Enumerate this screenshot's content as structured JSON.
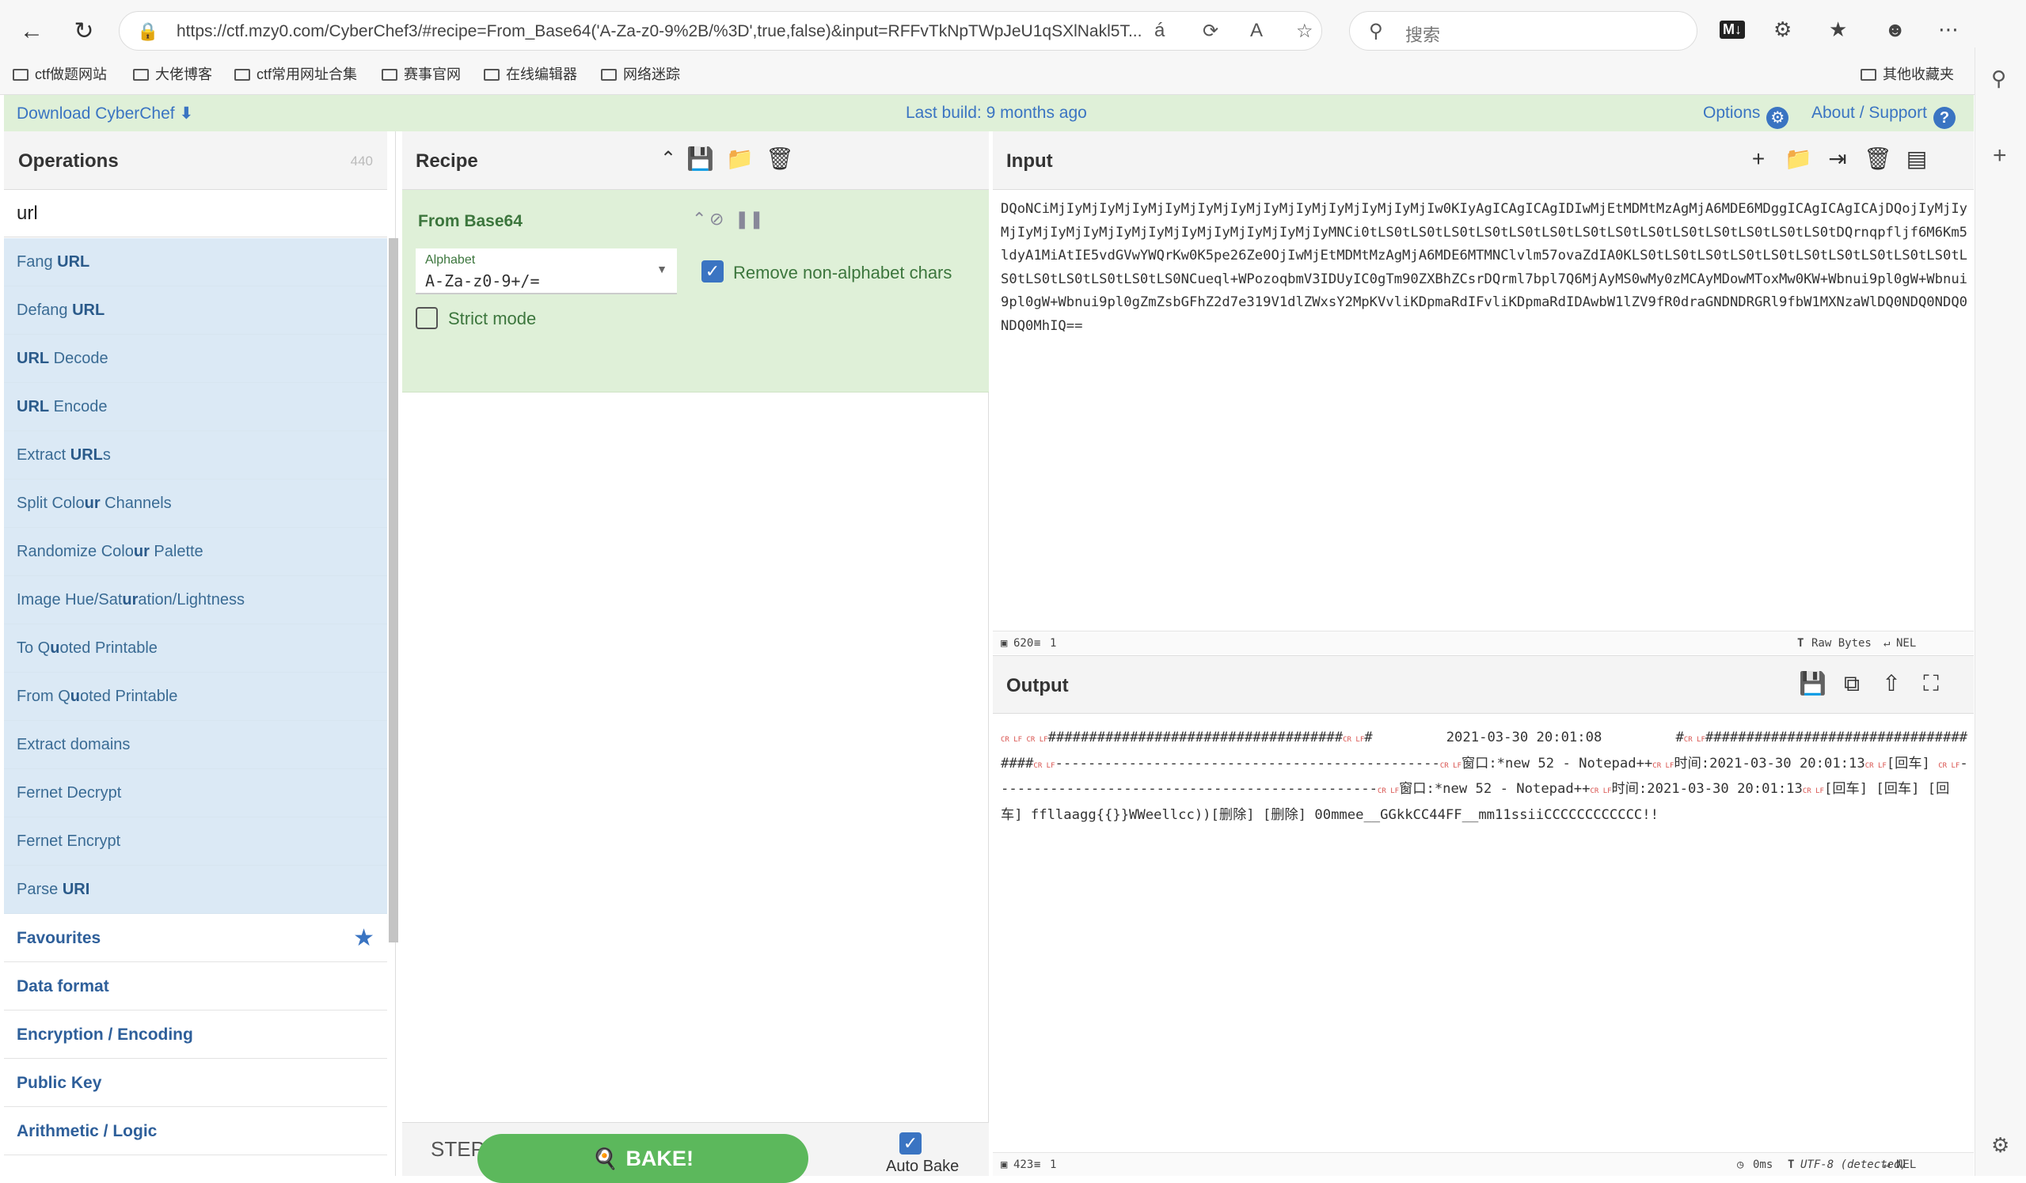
{
  "browser": {
    "url": "https://ctf.mzy0.com/CyberChef3/#recipe=From_Base64('A-Za-z0-9%2B/%3D',true,false)&input=RFFvTkNpTWpJeU1qSXlNakl5T...",
    "search_placeholder": "搜索",
    "bookmarks": [
      "ctf做题网站",
      "大佬博客",
      "ctf常用网址合集",
      "赛事官网",
      "在线编辑器",
      "网络迷踪"
    ],
    "other_bookmarks": "其他收藏夹"
  },
  "banner": {
    "download": "Download CyberChef",
    "last_build": "Last build: 9 months ago",
    "options": "Options",
    "about": "About / Support"
  },
  "operations": {
    "title": "Operations",
    "count": "440",
    "search_value": "url",
    "results": [
      {
        "pre": "Fang ",
        "hl": "URL",
        "post": ""
      },
      {
        "pre": "Defang ",
        "hl": "URL",
        "post": ""
      },
      {
        "pre": "",
        "hl": "URL",
        "post": " Decode"
      },
      {
        "pre": "",
        "hl": "URL",
        "post": " Encode"
      },
      {
        "pre": "Extract ",
        "hl": "URL",
        "post": "s"
      },
      {
        "pre": "Split Colo",
        "hl": "ur",
        "post": " Channels"
      },
      {
        "pre": "Randomize Colo",
        "hl": "ur",
        "post": " Palette"
      },
      {
        "pre": "Image Hue/Sat",
        "hl": "ur",
        "post": "ation/Lightness"
      },
      {
        "pre": "To Q",
        "hl": "u",
        "post": "oted Printable"
      },
      {
        "pre": "From Q",
        "hl": "u",
        "post": "oted Printable"
      },
      {
        "pre": "Extract domains",
        "hl": "",
        "post": ""
      },
      {
        "pre": "Fernet Decrypt",
        "hl": "",
        "post": ""
      },
      {
        "pre": "Fernet Encrypt",
        "hl": "",
        "post": ""
      },
      {
        "pre": "Parse ",
        "hl": "URI",
        "post": ""
      }
    ],
    "categories": [
      "Favourites",
      "Data format",
      "Encryption / Encoding",
      "Public Key",
      "Arithmetic / Logic"
    ]
  },
  "recipe": {
    "title": "Recipe",
    "operation": "From Base64",
    "alphabet_label": "Alphabet",
    "alphabet_value": "A-Za-z0-9+/=",
    "remove_label": "Remove non-alphabet chars",
    "strict_label": "Strict mode",
    "step": "STEP",
    "bake": "BAKE!",
    "auto_bake": "Auto Bake"
  },
  "input": {
    "title": "Input",
    "text": "DQoNCiMjIyMjIyMjIyMjIyMjIyMjIyMjIyMjIyMjIyMjIyMjIyMjIw0KIyAgICAgICAgIDIwMjEtMDMtMzAgMjA6MDE6MDggICAgICAgICAjDQojIyMjIyMjIyMjIyMjIyMjIyMjIyMjIyMjIyMjIyMjIyMjIyMNCi0tLS0tLS0tLS0tLS0tLS0tLS0tLS0tLS0tLS0tLS0tLS0tLS0tLS0tLS0tDQrnqpfljf6M6Km5ldyA1MiAtIE5vdGVwYWQrKw0K5pe26Ze0OjIwMjEtMDMtMzAgMjA6MDE6MTMNClvlm57ovaZdIA0KLS0tLS0tLS0tLS0tLS0tLS0tLS0tLS0tLS0tLS0tLS0tLS0tLS0tLS0tLS0tLS0NCueql+WPozoqbmV3IDUyIC0gTm90ZXBhZCsrDQrml7bpl7Q6MjAyMS0wMy0zMCAyMDowMToxMw0KW+Wbnui9pl0gW+Wbnui9pl0gW+Wbnui9pl0gZmZsbGFhZ2d7e319V1dlZWxsY2MpKVvliKDpmaRdIFvliKDpmaRdIDAwbW1lZV9fR0draGNDNDRGRl9fbW1MXNzaWlDQ0NDQ0NDQ0NDQ0MhIQ==",
    "length": "620",
    "lines": "1",
    "raw_bytes": "Raw Bytes",
    "eol": "NEL"
  },
  "output": {
    "title": "Output",
    "parts": [
      {
        "t": "crlf",
        "v": "CR LF CR LF"
      },
      {
        "t": "txt",
        "v": "####################################"
      },
      {
        "t": "crlf",
        "v": "CR LF"
      },
      {
        "t": "txt",
        "v": "#         2021-03-30 20:01:08         #"
      },
      {
        "t": "crlf",
        "v": "CR LF"
      },
      {
        "t": "txt",
        "v": "####################################"
      },
      {
        "t": "crlf",
        "v": "CR LF"
      },
      {
        "t": "txt",
        "v": "-----------------------------------------------"
      },
      {
        "t": "crlf",
        "v": "CR LF"
      },
      {
        "t": "txt",
        "v": "窗口:*new 52 - Notepad++"
      },
      {
        "t": "crlf",
        "v": "CR LF"
      },
      {
        "t": "txt",
        "v": "时间:2021-03-30 20:01:13"
      },
      {
        "t": "crlf",
        "v": "CR LF"
      },
      {
        "t": "txt",
        "v": "[回车] "
      },
      {
        "t": "crlf",
        "v": "CR LF"
      },
      {
        "t": "txt",
        "v": "-----------------------------------------------"
      },
      {
        "t": "crlf",
        "v": "CR LF"
      },
      {
        "t": "txt",
        "v": "窗口:*new 52 - Notepad++"
      },
      {
        "t": "crlf",
        "v": "CR LF"
      },
      {
        "t": "txt",
        "v": "时间:2021-03-30 20:01:13"
      },
      {
        "t": "crlf",
        "v": "CR LF"
      },
      {
        "t": "txt",
        "v": "[回车] [回车] [回车] ffllaagg{{}}WWeellcc))[删除] [删除] 00mmee__GGkkCC44FF__mm11ssiiCCCCCCCCCCCC!!"
      }
    ],
    "length": "423",
    "lines": "1",
    "time": "0ms",
    "encoding": "UTF-8 (detected)",
    "eol": "NEL"
  }
}
